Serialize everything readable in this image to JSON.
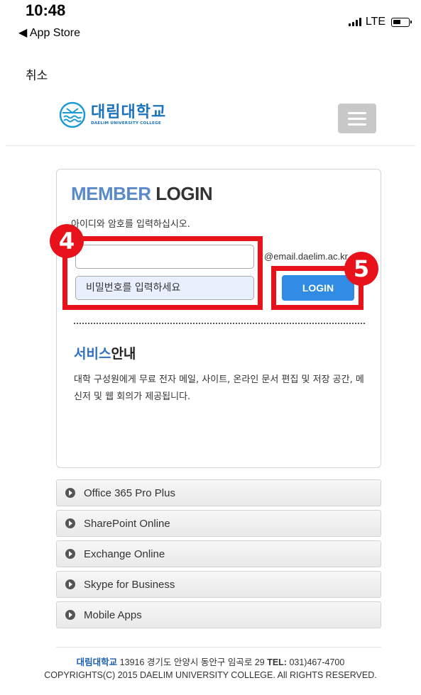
{
  "status_bar": {
    "time": "10:48",
    "back_label": "◀ App Store",
    "network": "LTE"
  },
  "nav": {
    "cancel_label": "취소"
  },
  "header": {
    "logo_main": "대림대학교",
    "logo_sub": "DAELIM UNIVERSITY COLLEGE",
    "menu_icon": "hamburger-menu-icon"
  },
  "login": {
    "title_part1": "MEMBER",
    "title_part2": "LOGIN",
    "instruction": "아이디와 암호를 입력하십시오.",
    "id_value": "",
    "id_placeholder": "",
    "email_suffix": "@email.daelim.ac.kr",
    "password_placeholder": "비밀번호를 입력하세요",
    "login_button": "LOGIN"
  },
  "service": {
    "title_part1": "서비스",
    "title_part2": "안내",
    "description": "대학 구성원에게 무료 전자 메일, 사이트, 온라인 문서 편집 및 저장 공간, 메신저 및 웹 회의가 제공됩니다."
  },
  "annotations": [
    {
      "label": "4",
      "color": "#e8121a"
    },
    {
      "label": "5",
      "color": "#e8121a"
    }
  ],
  "products": [
    {
      "label": "Office 365 Pro Plus"
    },
    {
      "label": "SharePoint Online"
    },
    {
      "label": "Exchange Online"
    },
    {
      "label": "Skype for Business"
    },
    {
      "label": "Mobile Apps"
    }
  ],
  "footer": {
    "brand": "대림대학교",
    "address": "13916 경기도 안양시 동안구 임곡로 29",
    "tel_label": "TEL:",
    "tel_value": "031)467-4700",
    "copyright": "COPYRIGHTS(C) 2015 DAELIM UNIVERSITY COLLEGE. All RIGHTS RESERVED."
  },
  "colors": {
    "accent_blue": "#2f8be3",
    "annotation_red": "#e8121a",
    "brand_blue": "#1a72bd"
  }
}
